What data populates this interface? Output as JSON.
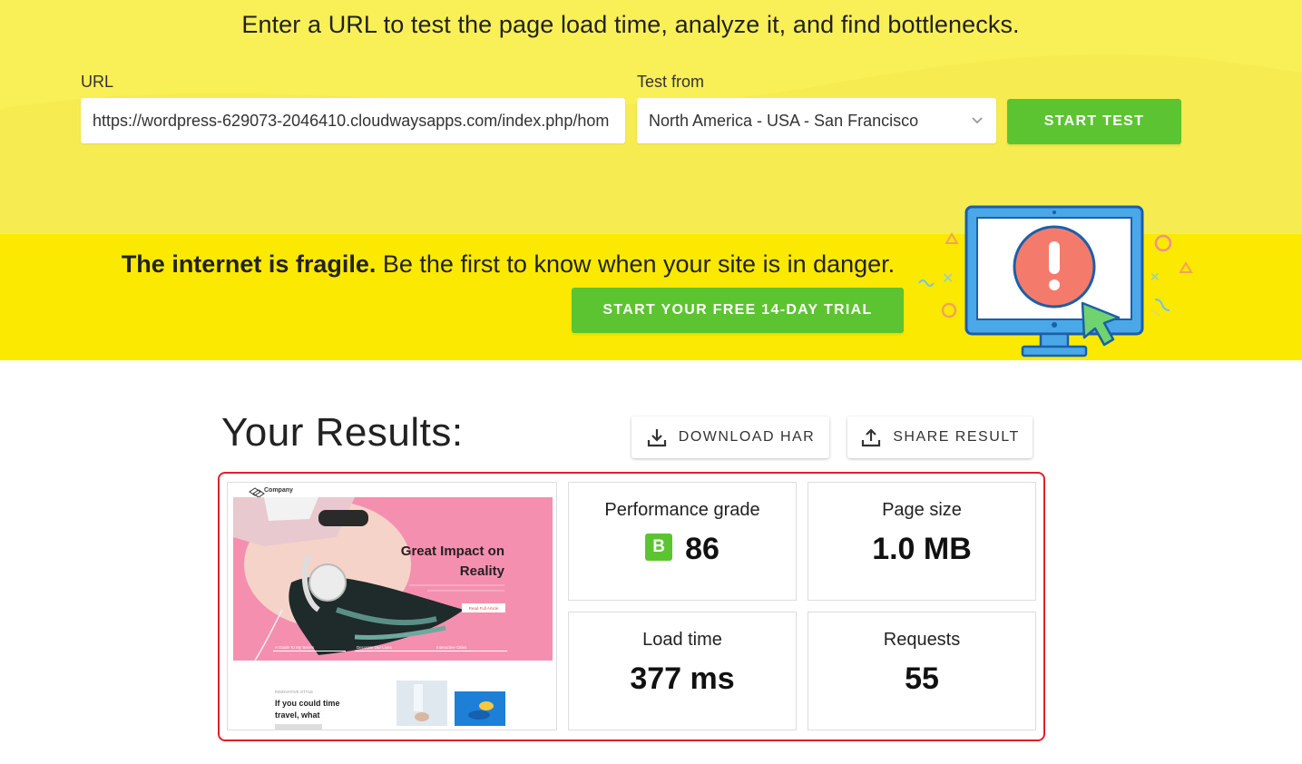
{
  "hero": {
    "title": "Enter a URL to test the page load time, analyze it, and find bottlenecks.",
    "url_label": "URL",
    "url_value": "https://wordpress-629073-2046410.cloudwaysapps.com/index.php/hom",
    "test_from_label": "Test from",
    "test_from_value": "North America - USA - San Francisco",
    "start_test_label": "START TEST"
  },
  "banner": {
    "bold_text": "The internet is fragile.",
    "text": " Be the first to know when your site is in danger.",
    "trial_button_label": "START YOUR FREE 14-DAY TRIAL"
  },
  "results": {
    "title": "Your Results:",
    "download_har_label": "DOWNLOAD HAR",
    "share_result_label": "SHARE RESULT",
    "thumbnail": {
      "brand": "Company",
      "headline_line1": "Great Impact on",
      "headline_line2": "Reality",
      "cta": "Read Full Article",
      "tabs": [
        "A Guide To My Series",
        "Decorate Our Lives",
        "Interactive Cities"
      ],
      "kicker": "INNOVATIVE STYLE",
      "teaser_line1": "If you could time",
      "teaser_line2": "travel, what"
    },
    "performance_grade": {
      "label": "Performance grade",
      "grade": "B",
      "score": "86"
    },
    "page_size": {
      "label": "Page size",
      "value": "1.0 MB"
    },
    "load_time": {
      "label": "Load time",
      "value": "377 ms"
    },
    "requests": {
      "label": "Requests",
      "value": "55"
    }
  },
  "colors": {
    "hero_bg": "#f9f058",
    "banner_bg": "#fbe901",
    "green": "#5cc431",
    "frame_red": "#e01e2d"
  }
}
